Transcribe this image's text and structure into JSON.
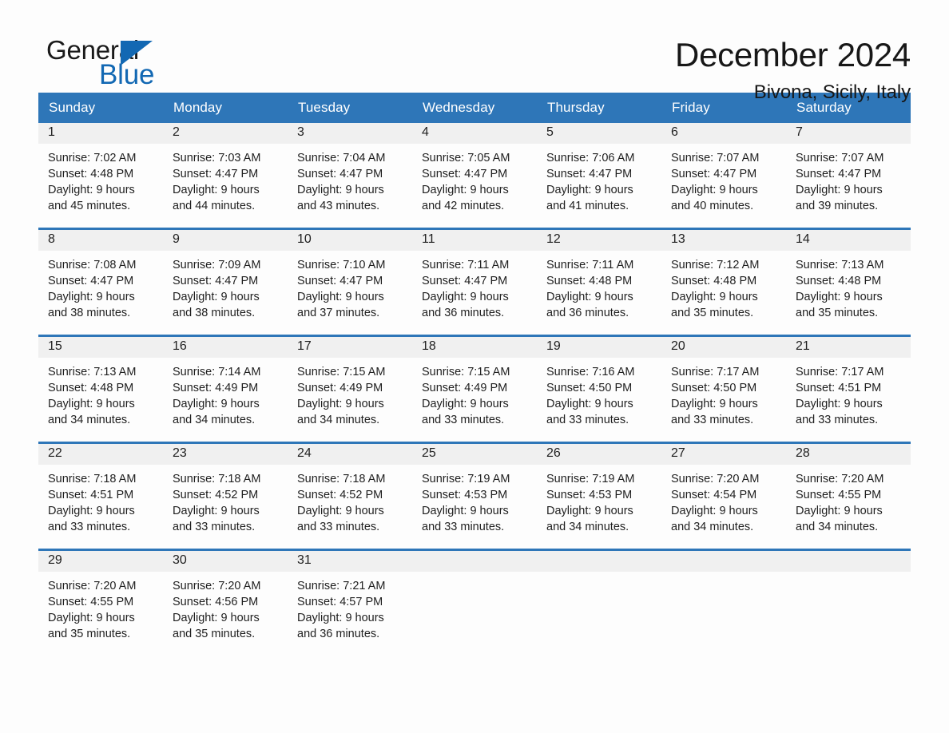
{
  "brand": {
    "name_top": "General",
    "name_bottom": "Blue",
    "accent_color": "#1268b3"
  },
  "header": {
    "month_title": "December 2024",
    "location": "Bivona, Sicily, Italy"
  },
  "theme": {
    "header_bg": "#2e76b8",
    "header_text": "#ffffff",
    "daynum_band_bg": "#f0f0f0",
    "page_bg": "#fdfdfd",
    "body_text": "#1f1f1f"
  },
  "weekday_headers": [
    "Sunday",
    "Monday",
    "Tuesday",
    "Wednesday",
    "Thursday",
    "Friday",
    "Saturday"
  ],
  "labels": {
    "sunrise_prefix": "Sunrise:",
    "sunset_prefix": "Sunset:",
    "daylight_prefix": "Daylight:"
  },
  "weeks": [
    [
      {
        "day": "1",
        "sunrise": "Sunrise: 7:02 AM",
        "sunset": "Sunset: 4:48 PM",
        "daylight_line1": "Daylight: 9 hours",
        "daylight_line2": "and 45 minutes."
      },
      {
        "day": "2",
        "sunrise": "Sunrise: 7:03 AM",
        "sunset": "Sunset: 4:47 PM",
        "daylight_line1": "Daylight: 9 hours",
        "daylight_line2": "and 44 minutes."
      },
      {
        "day": "3",
        "sunrise": "Sunrise: 7:04 AM",
        "sunset": "Sunset: 4:47 PM",
        "daylight_line1": "Daylight: 9 hours",
        "daylight_line2": "and 43 minutes."
      },
      {
        "day": "4",
        "sunrise": "Sunrise: 7:05 AM",
        "sunset": "Sunset: 4:47 PM",
        "daylight_line1": "Daylight: 9 hours",
        "daylight_line2": "and 42 minutes."
      },
      {
        "day": "5",
        "sunrise": "Sunrise: 7:06 AM",
        "sunset": "Sunset: 4:47 PM",
        "daylight_line1": "Daylight: 9 hours",
        "daylight_line2": "and 41 minutes."
      },
      {
        "day": "6",
        "sunrise": "Sunrise: 7:07 AM",
        "sunset": "Sunset: 4:47 PM",
        "daylight_line1": "Daylight: 9 hours",
        "daylight_line2": "and 40 minutes."
      },
      {
        "day": "7",
        "sunrise": "Sunrise: 7:07 AM",
        "sunset": "Sunset: 4:47 PM",
        "daylight_line1": "Daylight: 9 hours",
        "daylight_line2": "and 39 minutes."
      }
    ],
    [
      {
        "day": "8",
        "sunrise": "Sunrise: 7:08 AM",
        "sunset": "Sunset: 4:47 PM",
        "daylight_line1": "Daylight: 9 hours",
        "daylight_line2": "and 38 minutes."
      },
      {
        "day": "9",
        "sunrise": "Sunrise: 7:09 AM",
        "sunset": "Sunset: 4:47 PM",
        "daylight_line1": "Daylight: 9 hours",
        "daylight_line2": "and 38 minutes."
      },
      {
        "day": "10",
        "sunrise": "Sunrise: 7:10 AM",
        "sunset": "Sunset: 4:47 PM",
        "daylight_line1": "Daylight: 9 hours",
        "daylight_line2": "and 37 minutes."
      },
      {
        "day": "11",
        "sunrise": "Sunrise: 7:11 AM",
        "sunset": "Sunset: 4:47 PM",
        "daylight_line1": "Daylight: 9 hours",
        "daylight_line2": "and 36 minutes."
      },
      {
        "day": "12",
        "sunrise": "Sunrise: 7:11 AM",
        "sunset": "Sunset: 4:48 PM",
        "daylight_line1": "Daylight: 9 hours",
        "daylight_line2": "and 36 minutes."
      },
      {
        "day": "13",
        "sunrise": "Sunrise: 7:12 AM",
        "sunset": "Sunset: 4:48 PM",
        "daylight_line1": "Daylight: 9 hours",
        "daylight_line2": "and 35 minutes."
      },
      {
        "day": "14",
        "sunrise": "Sunrise: 7:13 AM",
        "sunset": "Sunset: 4:48 PM",
        "daylight_line1": "Daylight: 9 hours",
        "daylight_line2": "and 35 minutes."
      }
    ],
    [
      {
        "day": "15",
        "sunrise": "Sunrise: 7:13 AM",
        "sunset": "Sunset: 4:48 PM",
        "daylight_line1": "Daylight: 9 hours",
        "daylight_line2": "and 34 minutes."
      },
      {
        "day": "16",
        "sunrise": "Sunrise: 7:14 AM",
        "sunset": "Sunset: 4:49 PM",
        "daylight_line1": "Daylight: 9 hours",
        "daylight_line2": "and 34 minutes."
      },
      {
        "day": "17",
        "sunrise": "Sunrise: 7:15 AM",
        "sunset": "Sunset: 4:49 PM",
        "daylight_line1": "Daylight: 9 hours",
        "daylight_line2": "and 34 minutes."
      },
      {
        "day": "18",
        "sunrise": "Sunrise: 7:15 AM",
        "sunset": "Sunset: 4:49 PM",
        "daylight_line1": "Daylight: 9 hours",
        "daylight_line2": "and 33 minutes."
      },
      {
        "day": "19",
        "sunrise": "Sunrise: 7:16 AM",
        "sunset": "Sunset: 4:50 PM",
        "daylight_line1": "Daylight: 9 hours",
        "daylight_line2": "and 33 minutes."
      },
      {
        "day": "20",
        "sunrise": "Sunrise: 7:17 AM",
        "sunset": "Sunset: 4:50 PM",
        "daylight_line1": "Daylight: 9 hours",
        "daylight_line2": "and 33 minutes."
      },
      {
        "day": "21",
        "sunrise": "Sunrise: 7:17 AM",
        "sunset": "Sunset: 4:51 PM",
        "daylight_line1": "Daylight: 9 hours",
        "daylight_line2": "and 33 minutes."
      }
    ],
    [
      {
        "day": "22",
        "sunrise": "Sunrise: 7:18 AM",
        "sunset": "Sunset: 4:51 PM",
        "daylight_line1": "Daylight: 9 hours",
        "daylight_line2": "and 33 minutes."
      },
      {
        "day": "23",
        "sunrise": "Sunrise: 7:18 AM",
        "sunset": "Sunset: 4:52 PM",
        "daylight_line1": "Daylight: 9 hours",
        "daylight_line2": "and 33 minutes."
      },
      {
        "day": "24",
        "sunrise": "Sunrise: 7:18 AM",
        "sunset": "Sunset: 4:52 PM",
        "daylight_line1": "Daylight: 9 hours",
        "daylight_line2": "and 33 minutes."
      },
      {
        "day": "25",
        "sunrise": "Sunrise: 7:19 AM",
        "sunset": "Sunset: 4:53 PM",
        "daylight_line1": "Daylight: 9 hours",
        "daylight_line2": "and 33 minutes."
      },
      {
        "day": "26",
        "sunrise": "Sunrise: 7:19 AM",
        "sunset": "Sunset: 4:53 PM",
        "daylight_line1": "Daylight: 9 hours",
        "daylight_line2": "and 34 minutes."
      },
      {
        "day": "27",
        "sunrise": "Sunrise: 7:20 AM",
        "sunset": "Sunset: 4:54 PM",
        "daylight_line1": "Daylight: 9 hours",
        "daylight_line2": "and 34 minutes."
      },
      {
        "day": "28",
        "sunrise": "Sunrise: 7:20 AM",
        "sunset": "Sunset: 4:55 PM",
        "daylight_line1": "Daylight: 9 hours",
        "daylight_line2": "and 34 minutes."
      }
    ],
    [
      {
        "day": "29",
        "sunrise": "Sunrise: 7:20 AM",
        "sunset": "Sunset: 4:55 PM",
        "daylight_line1": "Daylight: 9 hours",
        "daylight_line2": "and 35 minutes."
      },
      {
        "day": "30",
        "sunrise": "Sunrise: 7:20 AM",
        "sunset": "Sunset: 4:56 PM",
        "daylight_line1": "Daylight: 9 hours",
        "daylight_line2": "and 35 minutes."
      },
      {
        "day": "31",
        "sunrise": "Sunrise: 7:21 AM",
        "sunset": "Sunset: 4:57 PM",
        "daylight_line1": "Daylight: 9 hours",
        "daylight_line2": "and 36 minutes."
      },
      {
        "day": "",
        "sunrise": "",
        "sunset": "",
        "daylight_line1": "",
        "daylight_line2": ""
      },
      {
        "day": "",
        "sunrise": "",
        "sunset": "",
        "daylight_line1": "",
        "daylight_line2": ""
      },
      {
        "day": "",
        "sunrise": "",
        "sunset": "",
        "daylight_line1": "",
        "daylight_line2": ""
      },
      {
        "day": "",
        "sunrise": "",
        "sunset": "",
        "daylight_line1": "",
        "daylight_line2": ""
      }
    ]
  ]
}
